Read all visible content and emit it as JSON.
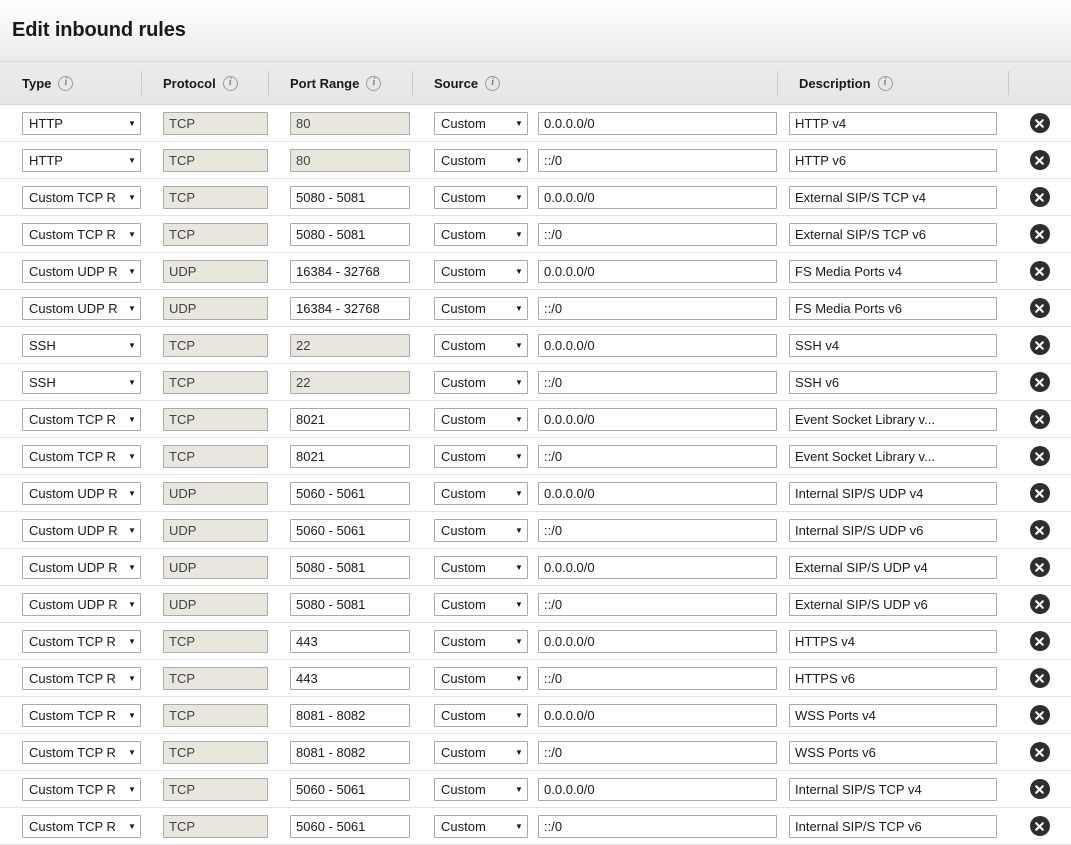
{
  "title": "Edit inbound rules",
  "icons": {
    "info": "info-icon",
    "delete": "delete-icon",
    "caret": "▼"
  },
  "columns": [
    {
      "key": "type",
      "label": "Type",
      "has_info": true
    },
    {
      "key": "protocol",
      "label": "Protocol",
      "has_info": true
    },
    {
      "key": "port_range",
      "label": "Port Range",
      "has_info": true
    },
    {
      "key": "source",
      "label": "Source",
      "has_info": true
    },
    {
      "key": "description",
      "label": "Description",
      "has_info": true
    },
    {
      "key": "actions",
      "label": "",
      "has_info": false
    }
  ],
  "source_option": "Custom",
  "rules": [
    {
      "type": "HTTP",
      "type_display": "HTTP",
      "protocol": "TCP",
      "port_range": "80",
      "port_editable": false,
      "source": "Custom",
      "cidr": "0.0.0.0/0",
      "description": "HTTP v4"
    },
    {
      "type": "HTTP",
      "type_display": "HTTP",
      "protocol": "TCP",
      "port_range": "80",
      "port_editable": false,
      "source": "Custom",
      "cidr": "::/0",
      "description": "HTTP v6"
    },
    {
      "type": "Custom TCP Rule",
      "type_display": "Custom TCP R",
      "protocol": "TCP",
      "port_range": "5080 - 5081",
      "port_editable": true,
      "source": "Custom",
      "cidr": "0.0.0.0/0",
      "description": "External SIP/S TCP v4"
    },
    {
      "type": "Custom TCP Rule",
      "type_display": "Custom TCP R",
      "protocol": "TCP",
      "port_range": "5080 - 5081",
      "port_editable": true,
      "source": "Custom",
      "cidr": "::/0",
      "description": "External SIP/S TCP v6"
    },
    {
      "type": "Custom UDP Rule",
      "type_display": "Custom UDP R",
      "protocol": "UDP",
      "port_range": "16384 - 32768",
      "port_editable": true,
      "source": "Custom",
      "cidr": "0.0.0.0/0",
      "description": "FS Media Ports v4"
    },
    {
      "type": "Custom UDP Rule",
      "type_display": "Custom UDP R",
      "protocol": "UDP",
      "port_range": "16384 - 32768",
      "port_editable": true,
      "source": "Custom",
      "cidr": "::/0",
      "description": "FS Media Ports v6"
    },
    {
      "type": "SSH",
      "type_display": "SSH",
      "protocol": "TCP",
      "port_range": "22",
      "port_editable": false,
      "source": "Custom",
      "cidr": "0.0.0.0/0",
      "description": "SSH v4"
    },
    {
      "type": "SSH",
      "type_display": "SSH",
      "protocol": "TCP",
      "port_range": "22",
      "port_editable": false,
      "source": "Custom",
      "cidr": "::/0",
      "description": "SSH v6"
    },
    {
      "type": "Custom TCP Rule",
      "type_display": "Custom TCP R",
      "protocol": "TCP",
      "port_range": "8021",
      "port_editable": true,
      "source": "Custom",
      "cidr": "0.0.0.0/0",
      "description": "Event Socket Library v..."
    },
    {
      "type": "Custom TCP Rule",
      "type_display": "Custom TCP R",
      "protocol": "TCP",
      "port_range": "8021",
      "port_editable": true,
      "source": "Custom",
      "cidr": "::/0",
      "description": "Event Socket Library v..."
    },
    {
      "type": "Custom UDP Rule",
      "type_display": "Custom UDP R",
      "protocol": "UDP",
      "port_range": "5060 - 5061",
      "port_editable": true,
      "source": "Custom",
      "cidr": "0.0.0.0/0",
      "description": "Internal SIP/S UDP v4"
    },
    {
      "type": "Custom UDP Rule",
      "type_display": "Custom UDP R",
      "protocol": "UDP",
      "port_range": "5060 - 5061",
      "port_editable": true,
      "source": "Custom",
      "cidr": "::/0",
      "description": "Internal SIP/S UDP v6"
    },
    {
      "type": "Custom UDP Rule",
      "type_display": "Custom UDP R",
      "protocol": "UDP",
      "port_range": "5080 - 5081",
      "port_editable": true,
      "source": "Custom",
      "cidr": "0.0.0.0/0",
      "description": "External SIP/S UDP v4"
    },
    {
      "type": "Custom UDP Rule",
      "type_display": "Custom UDP R",
      "protocol": "UDP",
      "port_range": "5080 - 5081",
      "port_editable": true,
      "source": "Custom",
      "cidr": "::/0",
      "description": "External SIP/S UDP v6"
    },
    {
      "type": "Custom TCP Rule",
      "type_display": "Custom TCP R",
      "protocol": "TCP",
      "port_range": "443",
      "port_editable": true,
      "source": "Custom",
      "cidr": "0.0.0.0/0",
      "description": "HTTPS v4"
    },
    {
      "type": "Custom TCP Rule",
      "type_display": "Custom TCP R",
      "protocol": "TCP",
      "port_range": "443",
      "port_editable": true,
      "source": "Custom",
      "cidr": "::/0",
      "description": "HTTPS v6"
    },
    {
      "type": "Custom TCP Rule",
      "type_display": "Custom TCP R",
      "protocol": "TCP",
      "port_range": "8081 - 8082",
      "port_editable": true,
      "source": "Custom",
      "cidr": "0.0.0.0/0",
      "description": "WSS Ports v4"
    },
    {
      "type": "Custom TCP Rule",
      "type_display": "Custom TCP R",
      "protocol": "TCP",
      "port_range": "8081 - 8082",
      "port_editable": true,
      "source": "Custom",
      "cidr": "::/0",
      "description": "WSS Ports v6"
    },
    {
      "type": "Custom TCP Rule",
      "type_display": "Custom TCP R",
      "protocol": "TCP",
      "port_range": "5060 - 5061",
      "port_editable": true,
      "source": "Custom",
      "cidr": "0.0.0.0/0",
      "description": "Internal SIP/S TCP v4"
    },
    {
      "type": "Custom TCP Rule",
      "type_display": "Custom TCP R",
      "protocol": "TCP",
      "port_range": "5060 - 5061",
      "port_editable": true,
      "source": "Custom",
      "cidr": "::/0",
      "description": "Internal SIP/S TCP v6"
    }
  ]
}
